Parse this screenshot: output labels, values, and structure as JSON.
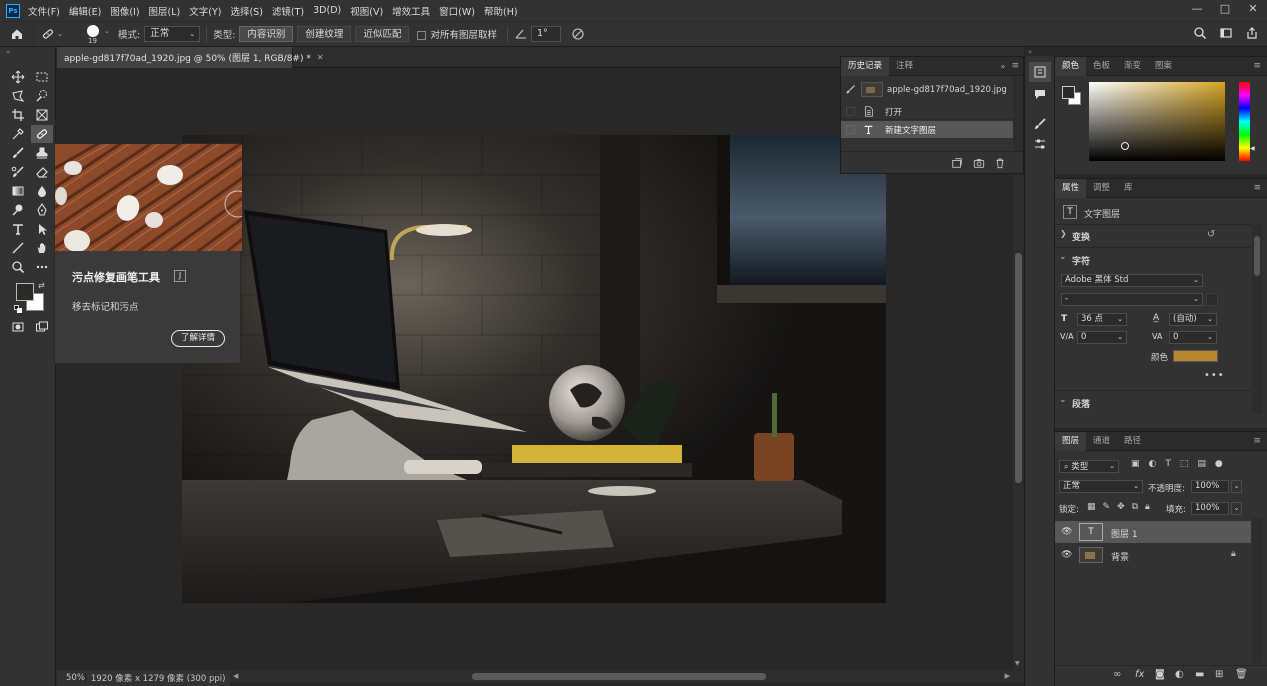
{
  "app": {
    "logo": "Ps"
  },
  "menu": [
    "文件(F)",
    "编辑(E)",
    "图像(I)",
    "图层(L)",
    "文字(Y)",
    "选择(S)",
    "滤镜(T)",
    "3D(D)",
    "视图(V)",
    "增效工具",
    "窗口(W)",
    "帮助(H)"
  ],
  "window_controls": {
    "minimize": "—",
    "maximize": "□",
    "close": "✕"
  },
  "options": {
    "brush_size": "19",
    "mode_label": "模式:",
    "mode_value": "正常",
    "type_label": "类型:",
    "type_buttons": [
      "内容识别",
      "创建纹理",
      "近似匹配"
    ],
    "sample_all_label": "对所有图层取样",
    "angle_value": "1°"
  },
  "document": {
    "tab_title": "apple-gd817f70ad_1920.jpg @ 50% (图层 1, RGB/8#) *",
    "zoom": "50%",
    "size_info": "1920 像素 x 1279 像素 (300 ppi)"
  },
  "tooltip": {
    "title": "污点修复画笔工具",
    "shortcut": "J",
    "description": "移去标记和污点",
    "learn_more": "了解详情"
  },
  "history": {
    "tabs": [
      "历史记录",
      "注释"
    ],
    "snapshot": "apple-gd817f70ad_1920.jpg",
    "items": [
      "打开",
      "新建文字图层"
    ]
  },
  "color_panel": {
    "tabs": [
      "颜色",
      "色板",
      "渐变",
      "图案"
    ],
    "accent": "#d4a422"
  },
  "properties": {
    "tabs": [
      "属性",
      "调整",
      "库"
    ],
    "layer_kind": "文字图层",
    "transform_label": "变换",
    "character_label": "字符",
    "font_family": "Adobe 黑体 Std",
    "font_style": "-",
    "font_size": "36 点",
    "leading": "(自动)",
    "kerning": "0",
    "tracking": "0",
    "color_label": "颜色",
    "text_color": "#b8862e",
    "paragraph_label": "段落"
  },
  "layers": {
    "tabs": [
      "图层",
      "通道",
      "路径"
    ],
    "filter": "类型",
    "blend_mode": "正常",
    "opacity_label": "不透明度:",
    "opacity": "100%",
    "lock_label": "锁定:",
    "fill_label": "填充:",
    "fill": "100%",
    "items": [
      {
        "name": "图层 1",
        "kind": "text"
      },
      {
        "name": "背景",
        "kind": "image"
      }
    ]
  }
}
